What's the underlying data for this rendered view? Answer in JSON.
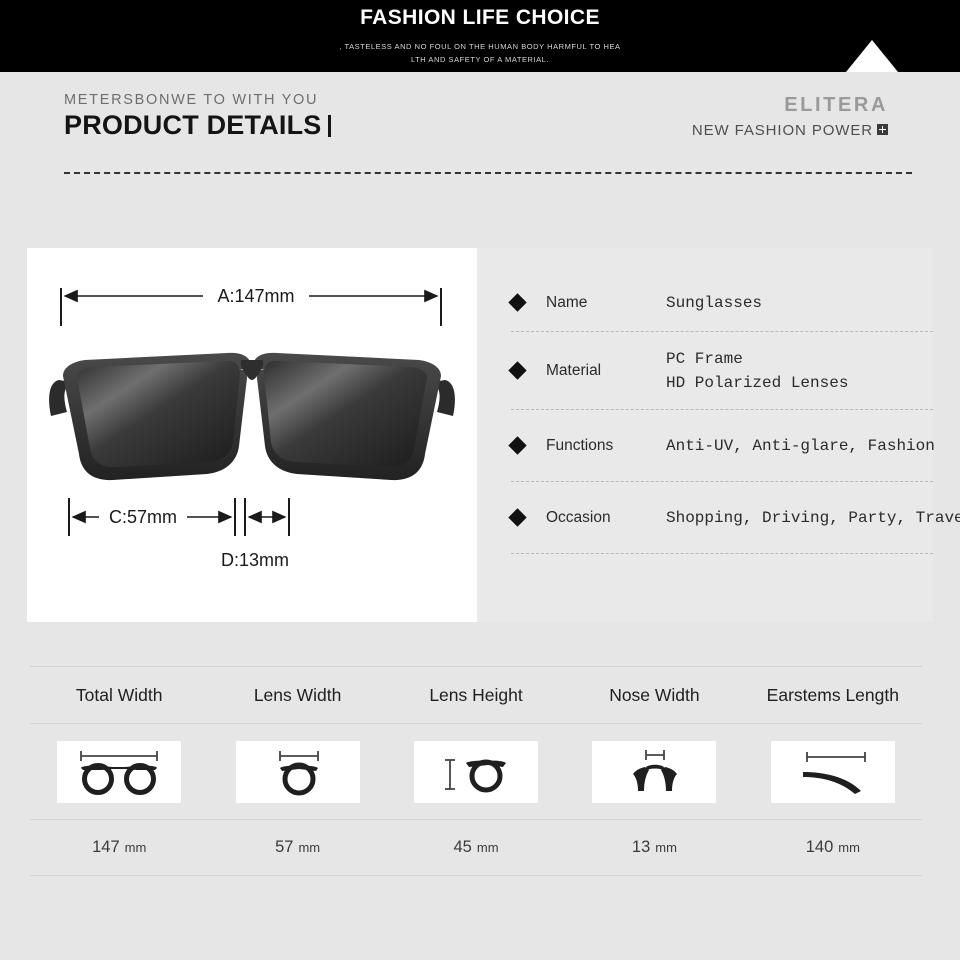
{
  "banner": {
    "title": "FASHION LIFE CHOICE",
    "subtitle_line1": ", TASTELESS AND NO FOUL ON THE HUMAN BODY HARMFUL TO HEA",
    "subtitle_line2": "LTH AND SAFETY OF A MATERIAL.",
    "background_color": "#000000",
    "triangle_color": "#ffffff"
  },
  "header": {
    "kicker": "METERSBONWE TO WITH YOU",
    "title": "PRODUCT DETAILS",
    "brand": "ELITERA",
    "brand_tagline": "NEW FASHION POWER",
    "brand_badge_icon": "plus-square-icon"
  },
  "diagram": {
    "measure_a": "A:147mm",
    "measure_c": "C:57mm",
    "measure_d": "D:13mm",
    "product_image_alt": "black square-frame polarized sunglasses front view"
  },
  "spec": {
    "rows": [
      {
        "label": "Name",
        "values": [
          "Sunglasses"
        ]
      },
      {
        "label": "Material",
        "values": [
          "PC Frame",
          "HD Polarized Lenses"
        ]
      },
      {
        "label": "Functions",
        "values": [
          "Anti-UV, Anti-glare, Fashion"
        ]
      },
      {
        "label": "Occasion",
        "values": [
          "Shopping, Driving, Party, Travel"
        ]
      }
    ]
  },
  "measurements": {
    "headers": [
      "Total Width",
      "Lens Width",
      "Lens Height",
      "Nose Width",
      "Earstems Length"
    ],
    "icons": [
      "total-width-icon",
      "lens-width-icon",
      "lens-height-icon",
      "nose-width-icon",
      "earstems-length-icon"
    ],
    "values": [
      "147",
      "57",
      "45",
      "13",
      "140"
    ],
    "unit": "mm"
  },
  "colors": {
    "page_background": "#e6e6e6",
    "card_background": "#ffffff",
    "spec_panel_background": "#e9e9e9",
    "accent_dark": "#111111",
    "brand_gray": "#9a9a9a"
  }
}
